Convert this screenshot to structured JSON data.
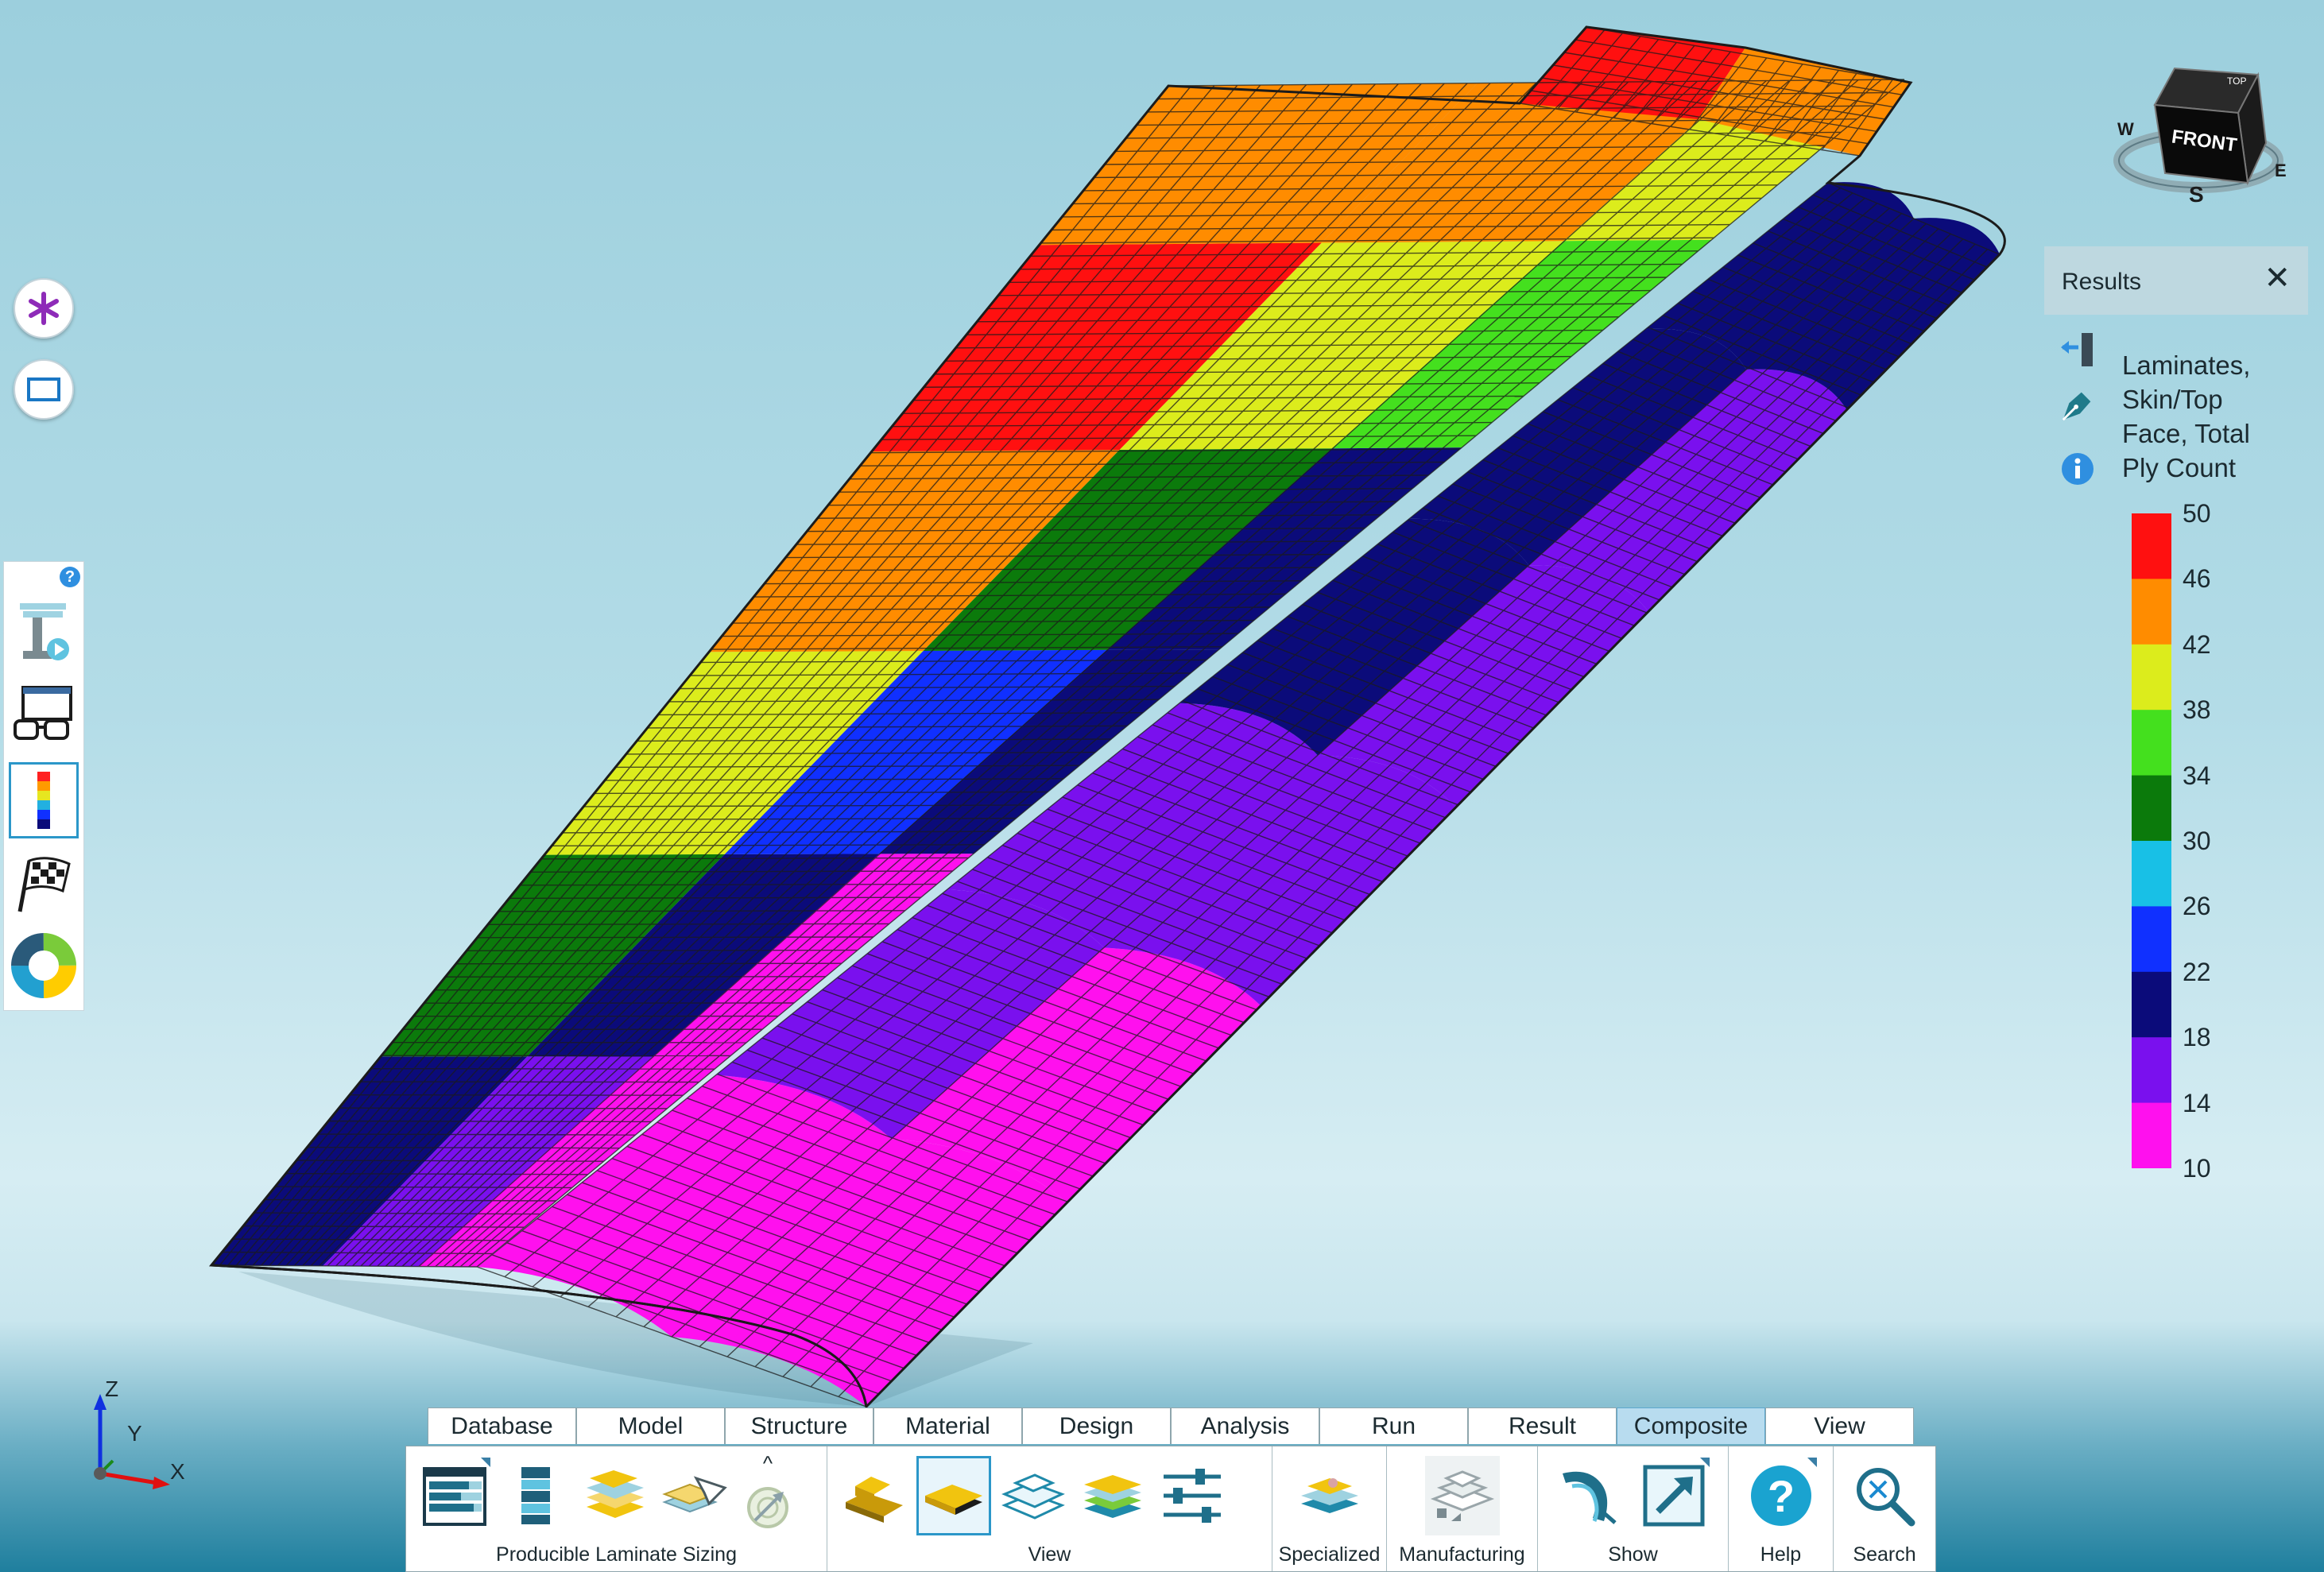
{
  "results": {
    "title": "Results",
    "close": "✕",
    "description_lines": [
      "Laminates,",
      "Skin/Top",
      "Face, Total",
      "Ply Count"
    ],
    "legend": {
      "labels": [
        "50",
        "46",
        "42",
        "38",
        "34",
        "30",
        "26",
        "22",
        "18",
        "14",
        "10"
      ],
      "colors": [
        "#ff1010",
        "#ff8c00",
        "#dcec1c",
        "#44e01e",
        "#0b7a0b",
        "#18c0e6",
        "#1030ff",
        "#0b0b7a",
        "#7a10ee",
        "#ff10ee"
      ]
    }
  },
  "viewcube": {
    "face": "FRONT",
    "top": "TOP",
    "compass": {
      "west": "W",
      "south": "S",
      "east": "E"
    }
  },
  "axes": {
    "z": "Z",
    "y": "Y",
    "x": "X"
  },
  "left_toolbar": {
    "help": "?",
    "icons": [
      "analysis-setup-icon",
      "view-glasses-icon",
      "color-legend-icon",
      "checkered-flag-icon",
      "color-wheel-icon"
    ],
    "active_index": 2
  },
  "ribbon": {
    "tabs": [
      "Database",
      "Model",
      "Structure",
      "Material",
      "Design",
      "Analysis",
      "Run",
      "Result",
      "Composite",
      "View"
    ],
    "active_tab": "Composite",
    "groups": [
      {
        "label": "Producible Laminate Sizing",
        "tools": [
          "laminate-table-icon",
          "ply-stack-icon",
          "ply-drop-icon",
          "ply-shape-icon",
          "ply-target-icon"
        ]
      },
      {
        "label": "View",
        "tools": [
          "laminate-solid-icon",
          "laminate-selected-icon",
          "laminate-outline-icon",
          "laminate-layers-icon",
          "sliders-icon"
        ]
      },
      {
        "label": "Specialized",
        "tools": [
          "specialized-plies-icon"
        ]
      },
      {
        "label": "Manufacturing",
        "tools": [
          "manufacturing-plies-icon"
        ]
      },
      {
        "label": "Show",
        "tools": [
          "show-drape-icon",
          "show-export-icon"
        ]
      },
      {
        "label": "Help",
        "tools": [
          "help-icon"
        ]
      },
      {
        "label": "Search",
        "tools": [
          "search-icon"
        ]
      }
    ],
    "collapse": "^"
  },
  "wing_plot": {
    "type": "heatmap",
    "quantity": "Total Ply Count",
    "region_colors": [
      "#ff1010",
      "#ff8c00",
      "#dcec1c",
      "#44e01e",
      "#0b7a0b",
      "#1030ff",
      "#0b0b7a",
      "#7a10ee",
      "#ff10ee"
    ]
  }
}
